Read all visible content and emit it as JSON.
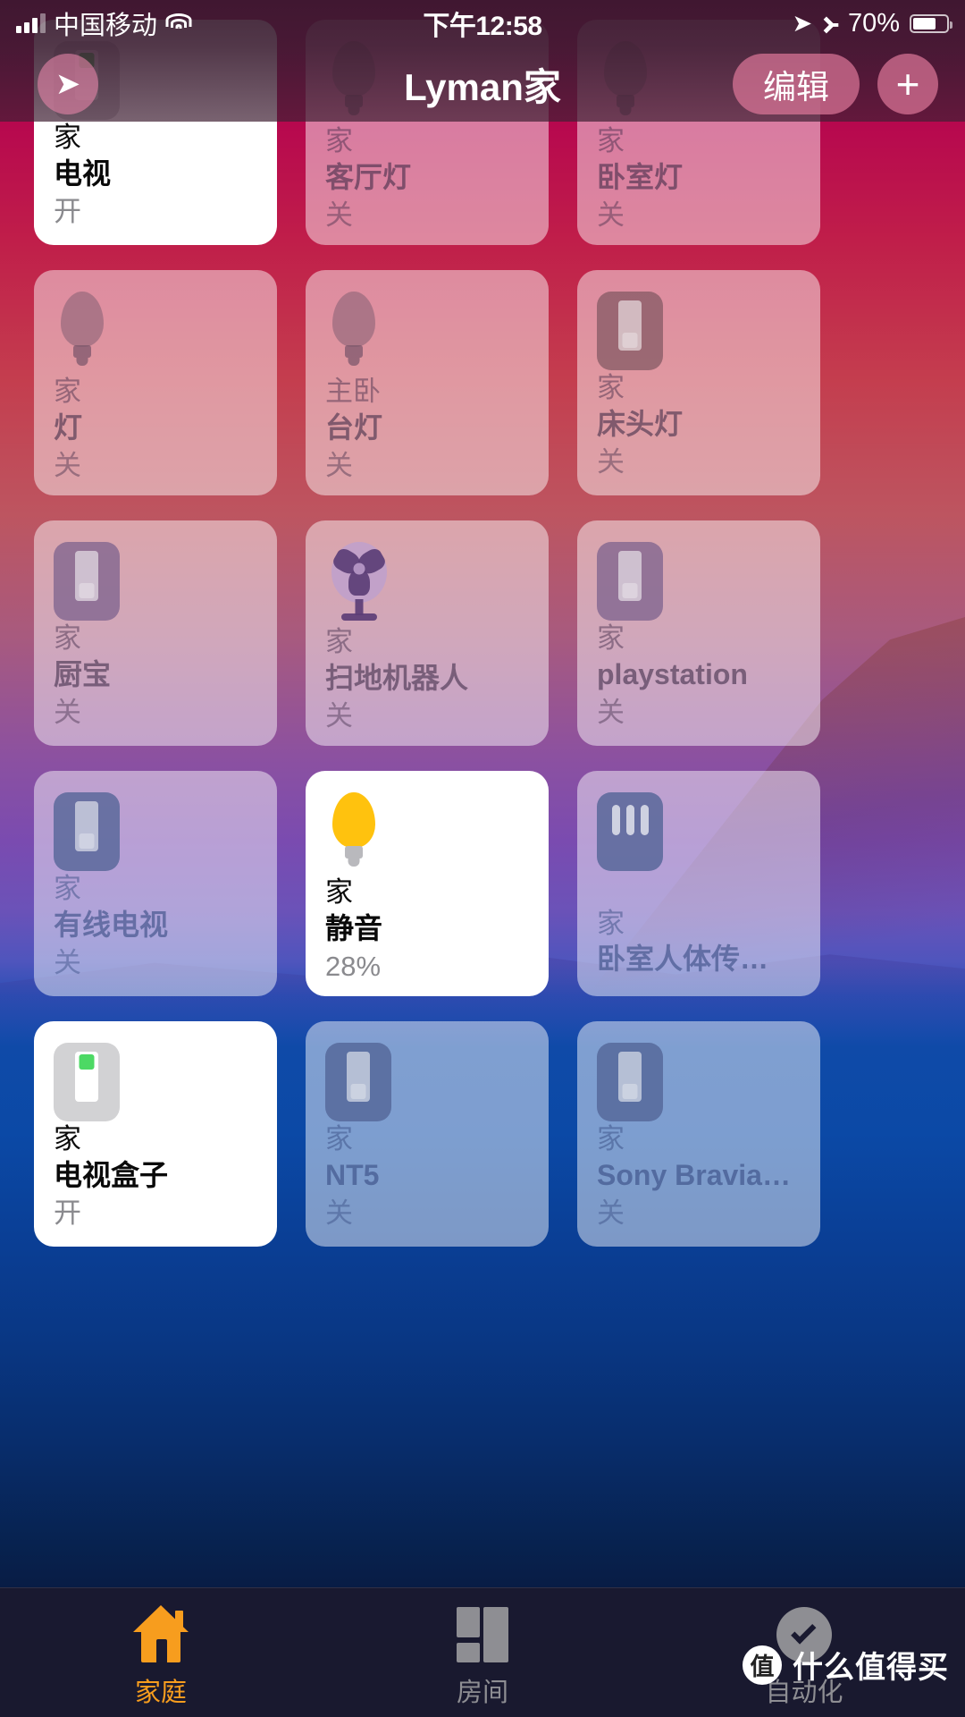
{
  "status_bar": {
    "carrier": "中国移动",
    "signal_icon": "signal-bars-icon",
    "wifi_icon": "wifi-icon",
    "time": "下午12:58",
    "location_icon": "location-arrow-icon",
    "bluetooth_icon": "bluetooth-icon",
    "battery_percent": "70%",
    "battery_icon": "battery-icon"
  },
  "nav_bar": {
    "location_button_icon": "location-arrow-icon",
    "title": "Lyman家",
    "edit_label": "编辑",
    "add_label": "+"
  },
  "accent_colors": {
    "active_tab": "#f79d1e",
    "bulb_on": "#ffc20e",
    "switch_on_indicator": "#4cd964",
    "nav_button": "#de789a"
  },
  "tiles": [
    {
      "room": "家",
      "name": "电视",
      "state": "开",
      "on": true,
      "icon": "switch-icon",
      "zone": "warm"
    },
    {
      "room": "家",
      "name": "客厅灯",
      "state": "关",
      "on": false,
      "icon": "bulb-icon",
      "zone": "warm"
    },
    {
      "room": "家",
      "name": "卧室灯",
      "state": "关",
      "on": false,
      "icon": "bulb-icon",
      "zone": "warm"
    },
    {
      "room": "家",
      "name": "灯",
      "state": "关",
      "on": false,
      "icon": "bulb-icon",
      "zone": "warm"
    },
    {
      "room": "主卧",
      "name": "台灯",
      "state": "关",
      "on": false,
      "icon": "bulb-icon",
      "zone": "warm"
    },
    {
      "room": "家",
      "name": "床头灯",
      "state": "关",
      "on": false,
      "icon": "switch-icon",
      "zone": "warm"
    },
    {
      "room": "家",
      "name": "厨宝",
      "state": "关",
      "on": false,
      "icon": "switch-icon",
      "zone": "mid"
    },
    {
      "room": "家",
      "name": "扫地机器人",
      "state": "关",
      "on": false,
      "icon": "fan-icon",
      "zone": "mid"
    },
    {
      "room": "家",
      "name": "playstation",
      "state": "关",
      "on": false,
      "icon": "switch-icon",
      "zone": "mid"
    },
    {
      "room": "家",
      "name": "有线电视",
      "state": "关",
      "on": false,
      "icon": "switch-icon",
      "zone": "blue"
    },
    {
      "room": "家",
      "name": "静音",
      "state": "28%",
      "on": true,
      "icon": "bulb-icon",
      "zone": "blue"
    },
    {
      "room": "家",
      "name": "卧室人体传…",
      "state": "",
      "on": false,
      "icon": "sensor-icon",
      "zone": "blue"
    },
    {
      "room": "家",
      "name": "电视盒子",
      "state": "开",
      "on": true,
      "icon": "switch-icon",
      "zone": "blue"
    },
    {
      "room": "家",
      "name": "NT5",
      "state": "关",
      "on": false,
      "icon": "switch-icon",
      "zone": "blue"
    },
    {
      "room": "家",
      "name": "Sony Bravia…",
      "state": "关",
      "on": false,
      "icon": "switch-icon",
      "zone": "blue"
    }
  ],
  "tab_bar": {
    "tabs": [
      {
        "label": "家庭",
        "icon": "house-icon",
        "active": true
      },
      {
        "label": "房间",
        "icon": "rooms-icon",
        "active": false
      },
      {
        "label": "自动化",
        "icon": "automation-icon",
        "active": false
      }
    ]
  },
  "watermark": {
    "logo": "值",
    "text": "什么值得买"
  }
}
